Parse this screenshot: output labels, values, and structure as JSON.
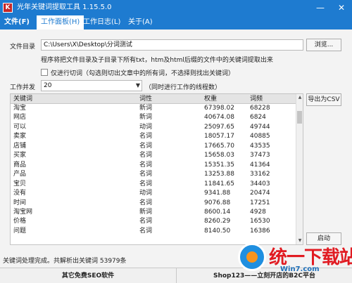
{
  "window": {
    "app_icon_glyph": "K",
    "title": "光年关键词提取工具 1.15.5.0",
    "minimize": "—",
    "close": "✕"
  },
  "menu": [
    {
      "label": "文件(F)",
      "active": false,
      "bold": true
    },
    {
      "label": "工作面板(H)",
      "active": true,
      "bold": false
    },
    {
      "label": "工作日志(L)",
      "active": false,
      "bold": false
    },
    {
      "label": "关于(A)",
      "active": false,
      "bold": false
    }
  ],
  "file_dir": {
    "label": "文件目录",
    "value": "C:\\Users\\X\\Desktop\\分词测试",
    "browse_button": "浏览..."
  },
  "hint_text": "程序将把文件目录及子目录下所有txt，htm及html后缀的文件中的关键词提取出来",
  "only_segment": {
    "checked": false,
    "label": "仅进行切词（勾选则切出文章中的所有词，不选择则找出关键词）"
  },
  "concurrency": {
    "label": "工作并发",
    "value": "20",
    "hint": "（同时进行工作的线程数）"
  },
  "export_button": "导出为CSV",
  "start_button": "启动",
  "table": {
    "columns": [
      "关键词",
      "词性",
      "权重",
      "词频"
    ],
    "rows": [
      [
        "淘宝",
        "新词",
        "67398.02",
        "68228"
      ],
      [
        "网店",
        "新词",
        "40674.08",
        "6824"
      ],
      [
        "可以",
        "动词",
        "25097.65",
        "49744"
      ],
      [
        "卖家",
        "名词",
        "18057.17",
        "40885"
      ],
      [
        "店铺",
        "名词",
        "17665.70",
        "43535"
      ],
      [
        "买家",
        "名词",
        "15658.03",
        "37473"
      ],
      [
        "商品",
        "名词",
        "15351.35",
        "41364"
      ],
      [
        "产品",
        "名词",
        "13253.88",
        "33162"
      ],
      [
        "宝贝",
        "名词",
        "11841.65",
        "34403"
      ],
      [
        "没有",
        "动词",
        "9341.88",
        "20474"
      ],
      [
        "时间",
        "名词",
        "9076.88",
        "17251"
      ],
      [
        "淘宝网",
        "新词",
        "8600.14",
        "4928"
      ],
      [
        "价格",
        "名词",
        "8260.29",
        "16530"
      ],
      [
        "问题",
        "名词",
        "8140.50",
        "16386"
      ]
    ],
    "scroll_fraction": 0.08
  },
  "status_text": "关键词处理完成。共解析出关键词 53979条",
  "footer": {
    "left_button": "其它免费SEO软件",
    "right_button": "Shop123——立刻开店的B2C平台"
  },
  "watermark": {
    "text": "统一下载站",
    "url": "Win7.com"
  },
  "colors": {
    "accent": "#1e7bd0",
    "watermark_red": "#e11b22",
    "watermark_blue": "#1f8fe0"
  }
}
